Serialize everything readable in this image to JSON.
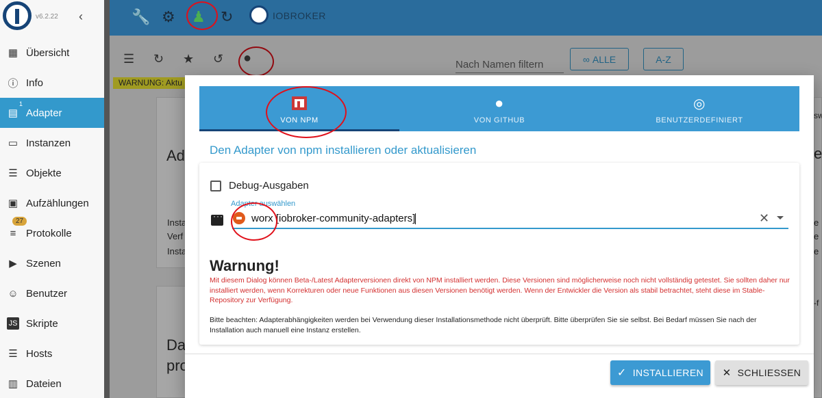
{
  "sidebar": {
    "version": "v6.2.22",
    "items": [
      {
        "label": "Übersicht",
        "icon": "grid-icon"
      },
      {
        "label": "Info",
        "icon": "info-icon"
      },
      {
        "label": "Adapter",
        "icon": "store-icon",
        "sup": "1"
      },
      {
        "label": "Instanzen",
        "icon": "instances-icon"
      },
      {
        "label": "Objekte",
        "icon": "list-icon"
      },
      {
        "label": "Aufzählungen",
        "icon": "enum-icon"
      },
      {
        "label": "Protokolle",
        "icon": "log-icon",
        "badge": "27"
      },
      {
        "label": "Szenen",
        "icon": "scenes-icon"
      },
      {
        "label": "Benutzer",
        "icon": "user-icon"
      },
      {
        "label": "Skripte",
        "icon": "js-icon"
      },
      {
        "label": "Hosts",
        "icon": "hosts-icon"
      },
      {
        "label": "Dateien",
        "icon": "files-icon"
      }
    ]
  },
  "topbar": {
    "brand": "IOBROKER"
  },
  "toolbar": {
    "filter_placeholder": "Nach Namen filtern",
    "all_button": "ALLE",
    "az_button": "A-Z",
    "warning": "WARNUNG: Aktu"
  },
  "dialog": {
    "tabs": [
      {
        "label": "VON NPM",
        "icon": "npm-icon"
      },
      {
        "label": "VON GITHUB",
        "icon": "github-icon"
      },
      {
        "label": "BENUTZERDEFINIERT",
        "icon": "globe-icon"
      }
    ],
    "title": "Den Adapter von npm installieren oder aktualisieren",
    "debug_label": "Debug-Ausgaben",
    "debug_checked": false,
    "select_label": "Adapter auswählen",
    "select_value": "worx [iobroker-community-adapters]",
    "warning_title": "Warnung!",
    "warning_text": "Mit diesem Dialog können Beta-/Latest Adapterversionen direkt von NPM installiert werden. Diese Versionen sind möglicherweise noch nicht vollständig getestet. Sie sollten daher nur installiert werden, wenn Korrekturen oder neue Funktionen aus diesen Versionen benötigt werden. Wenn der Entwickler die Version als stabil betrachtet, steht diese im Stable-Repository zur Verfügung.",
    "note_text": "Bitte beachten: Adapterabhängigkeiten werden bei Verwendung dieser Installationsmethode nicht überprüft. Bitte überprüfen Sie sie selbst. Bei Bedarf müssen Sie nach der Installation auch manuell eine Instanz erstellen.",
    "install_button": "INSTALLIEREN",
    "close_button": "SCHLIESSEN"
  },
  "background": {
    "card1_title": "Ad",
    "card1_lines": [
      "Insta",
      "Verf",
      "Insta"
    ],
    "card2_title": "Da",
    "card2_sub": "pro",
    "right_texts": [
      "sw",
      "e",
      "e",
      "e",
      "e",
      "-f"
    ]
  },
  "colors": {
    "accent": "#3c9ad3",
    "active_nav": "#3399cc",
    "warning_red": "#d32f2f",
    "warning_bar": "#f6ee34"
  }
}
